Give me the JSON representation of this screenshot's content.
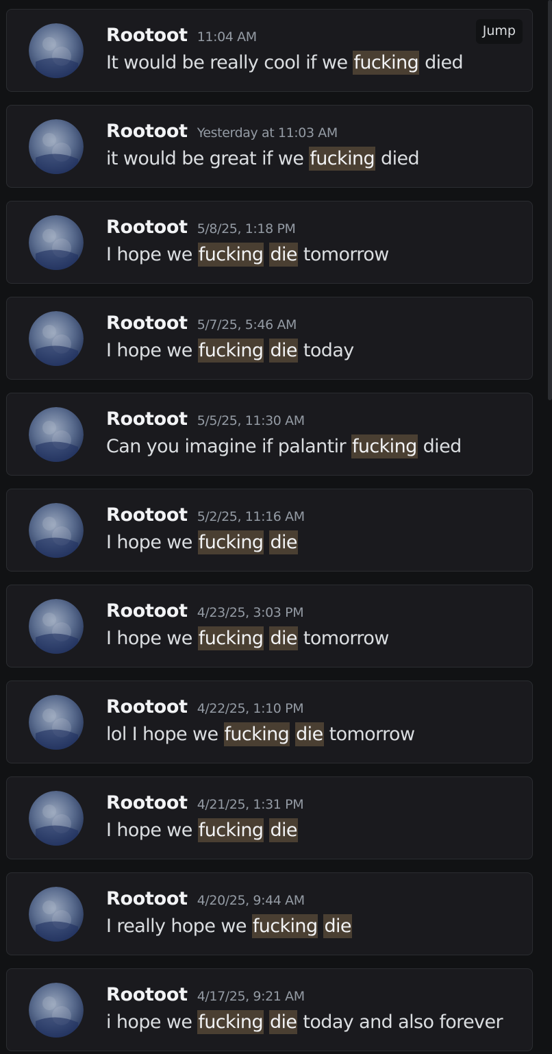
{
  "results": [
    {
      "author": "Rootoot",
      "timestamp": "11:04 AM",
      "segments": [
        {
          "t": "It would be really cool if we "
        },
        {
          "t": "fucking",
          "hl": true
        },
        {
          "t": " died"
        }
      ],
      "jump_label": "Jump"
    },
    {
      "author": "Rootoot",
      "timestamp": "Yesterday at 11:03 AM",
      "segments": [
        {
          "t": "it would be great if we "
        },
        {
          "t": "fucking",
          "hl": true
        },
        {
          "t": " died"
        }
      ]
    },
    {
      "author": "Rootoot",
      "timestamp": "5/8/25, 1:18 PM",
      "segments": [
        {
          "t": "I hope we "
        },
        {
          "t": "fucking",
          "hl": true
        },
        {
          "t": " "
        },
        {
          "t": "die",
          "hl": true
        },
        {
          "t": " tomorrow"
        }
      ]
    },
    {
      "author": "Rootoot",
      "timestamp": "5/7/25, 5:46 AM",
      "segments": [
        {
          "t": "I hope we "
        },
        {
          "t": "fucking",
          "hl": true
        },
        {
          "t": " "
        },
        {
          "t": "die",
          "hl": true
        },
        {
          "t": " today"
        }
      ]
    },
    {
      "author": "Rootoot",
      "timestamp": "5/5/25, 11:30 AM",
      "segments": [
        {
          "t": "Can you imagine if palantir "
        },
        {
          "t": "fucking",
          "hl": true
        },
        {
          "t": " died"
        }
      ]
    },
    {
      "author": "Rootoot",
      "timestamp": "5/2/25, 11:16 AM",
      "segments": [
        {
          "t": "I hope we "
        },
        {
          "t": "fucking",
          "hl": true
        },
        {
          "t": " "
        },
        {
          "t": "die",
          "hl": true
        }
      ]
    },
    {
      "author": "Rootoot",
      "timestamp": "4/23/25, 3:03 PM",
      "segments": [
        {
          "t": "I hope we "
        },
        {
          "t": "fucking",
          "hl": true
        },
        {
          "t": " "
        },
        {
          "t": "die",
          "hl": true
        },
        {
          "t": " tomorrow"
        }
      ]
    },
    {
      "author": "Rootoot",
      "timestamp": "4/22/25, 1:10 PM",
      "segments": [
        {
          "t": "lol I hope we "
        },
        {
          "t": "fucking",
          "hl": true
        },
        {
          "t": " "
        },
        {
          "t": "die",
          "hl": true
        },
        {
          "t": " tomorrow"
        }
      ]
    },
    {
      "author": "Rootoot",
      "timestamp": "4/21/25, 1:31 PM",
      "segments": [
        {
          "t": "I hope we "
        },
        {
          "t": "fucking",
          "hl": true
        },
        {
          "t": " "
        },
        {
          "t": "die",
          "hl": true
        }
      ]
    },
    {
      "author": "Rootoot",
      "timestamp": "4/20/25, 9:44 AM",
      "segments": [
        {
          "t": "I really hope we "
        },
        {
          "t": "fucking",
          "hl": true
        },
        {
          "t": " "
        },
        {
          "t": "die",
          "hl": true
        }
      ]
    },
    {
      "author": "Rootoot",
      "timestamp": "4/17/25, 9:21 AM",
      "segments": [
        {
          "t": "i hope we "
        },
        {
          "t": "fucking",
          "hl": true
        },
        {
          "t": " "
        },
        {
          "t": "die",
          "hl": true
        },
        {
          "t": " today and also forever"
        }
      ]
    }
  ],
  "scrollbar": {
    "position_fraction": 0.0,
    "visible_fraction": 0.38
  },
  "colors": {
    "highlight": "#4a3f32",
    "card": "#1a1a1e",
    "background": "#111214"
  }
}
